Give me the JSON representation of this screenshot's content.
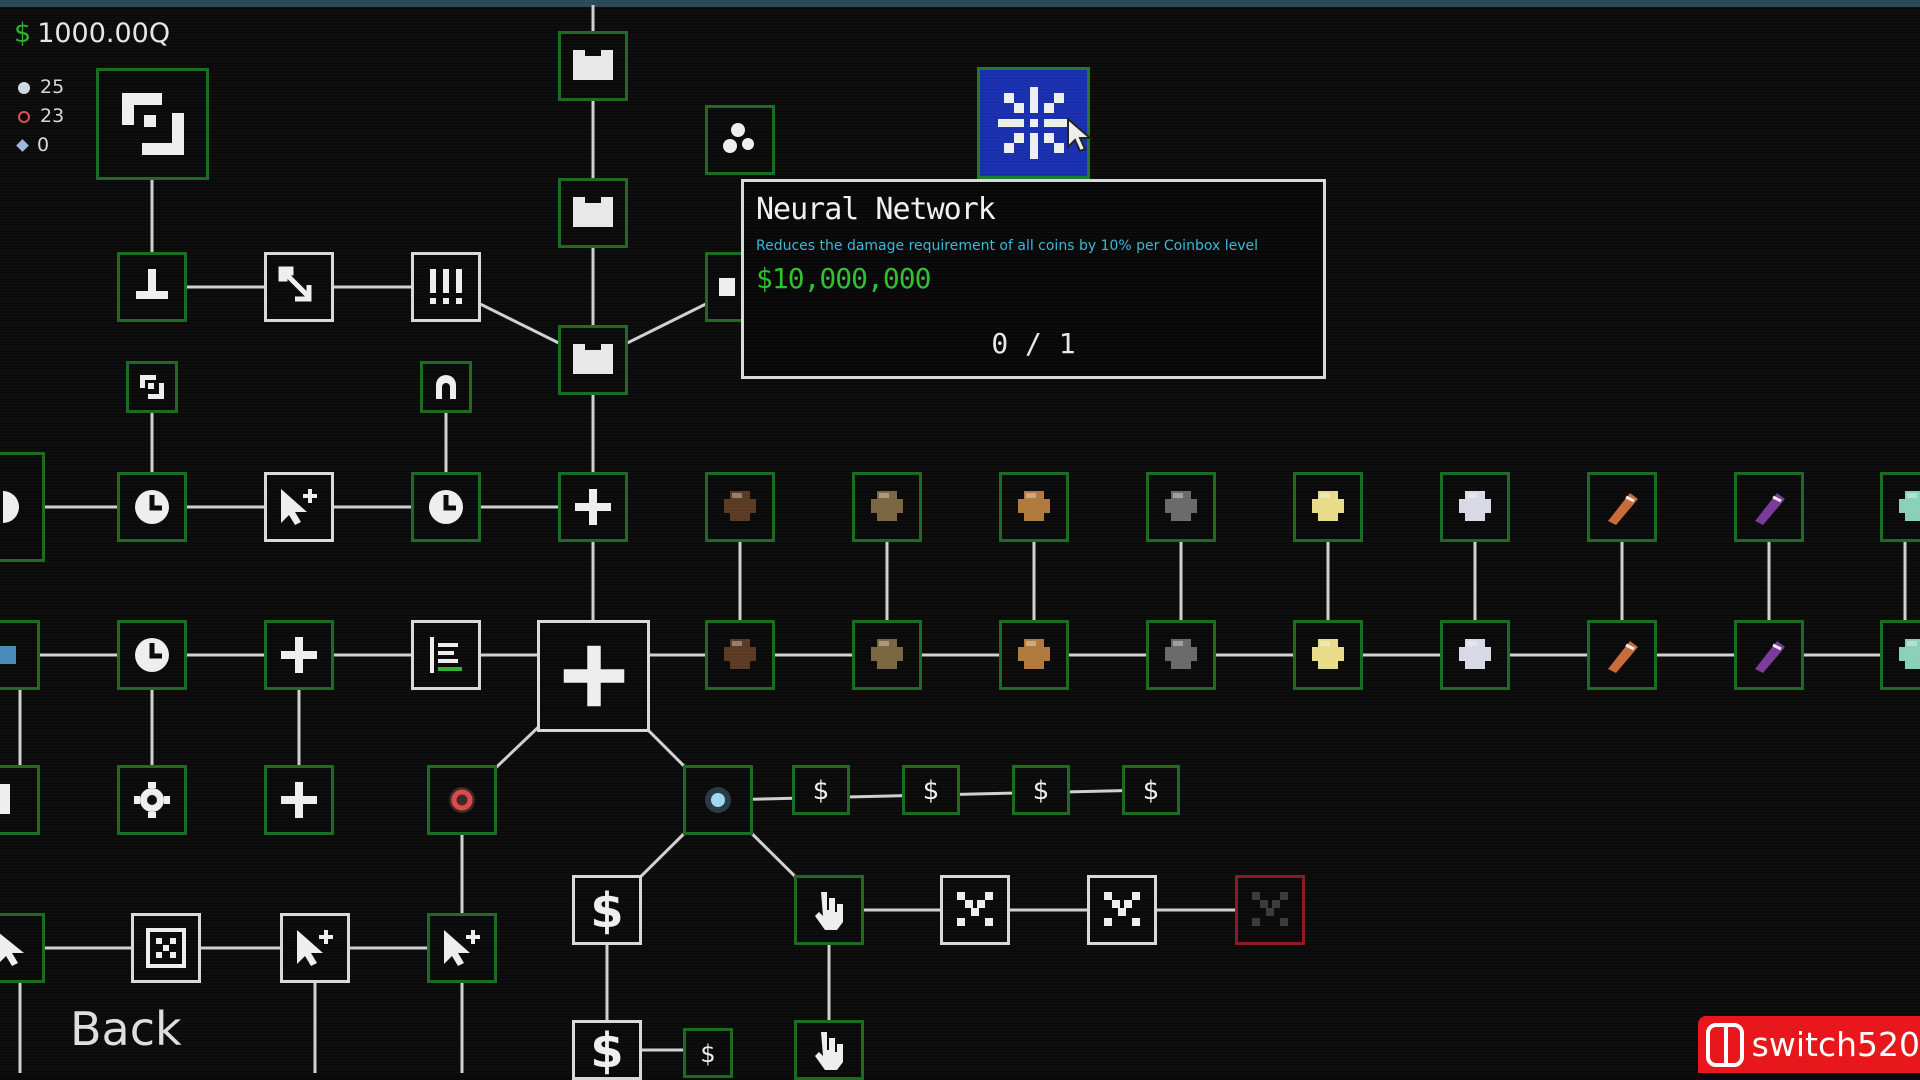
{
  "hud": {
    "money_symbol": "$",
    "money": "1000.00Q",
    "counters": [
      {
        "icon": "white-orb-icon",
        "value": "25"
      },
      {
        "icon": "red-ring-icon",
        "value": "23"
      },
      {
        "icon": "diamond-icon",
        "value": "0"
      }
    ]
  },
  "tooltip": {
    "title": "Neural Network",
    "description": "Reduces the damage requirement of all coins by 10% per Coinbox level",
    "price": "$10,000,000",
    "level": "0 / 1"
  },
  "back_label": "Back",
  "watermark": "switch520",
  "ore_colors": [
    "#5a3a22",
    "#7a6640",
    "#b07a3c",
    "#6a6a6a",
    "#e8dc8a",
    "#d8d8e6",
    "#c86a3a",
    "#7a3a9a",
    "#8ad0b8"
  ],
  "colors": {
    "edge": "#d0d0d0",
    "unlocked": "#1b6b22",
    "selected": "#1a2fae",
    "locked": "#8a1b1b",
    "price": "#2fbf2f",
    "desc": "#3bb8d6"
  }
}
